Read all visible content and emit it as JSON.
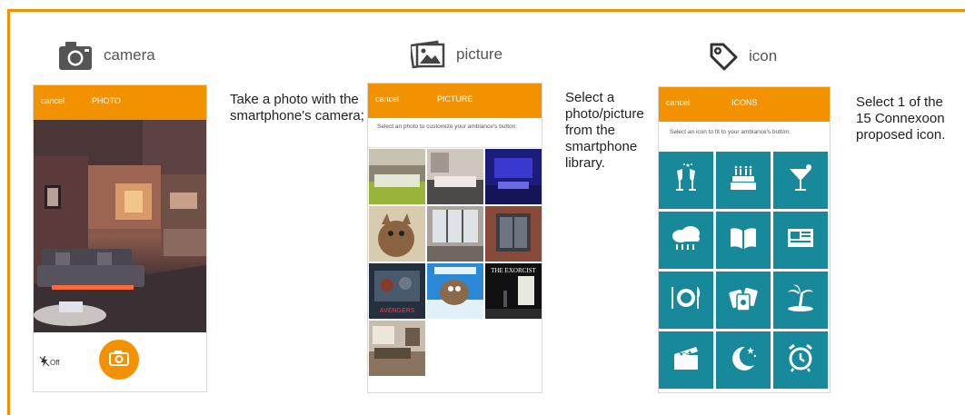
{
  "sections": {
    "camera": {
      "label": "camera",
      "phone": {
        "cancel": "cancel",
        "title": "PHOTO",
        "flash_label": "Off"
      },
      "description": "Take a photo with the smartphone's camera;"
    },
    "picture": {
      "label": "picture",
      "phone": {
        "cancel": "cancel",
        "title": "PICTURE",
        "hint": "Select an photo to customize your ambiance's button:",
        "photos": [
          "bedroom-green",
          "bedroom-grey",
          "bedroom-blue",
          "kitten",
          "loft-window",
          "brick-window",
          "avengers-poster",
          "ice-age-poster",
          "exorcist-poster",
          "living-room"
        ],
        "poster_text": {
          "exorcist": "THE EXORCIST",
          "avengers": "AVENGERS"
        }
      },
      "description": "Select a photo/picture from the smartphone library."
    },
    "icon": {
      "label": "icon",
      "phone": {
        "cancel": "cancel",
        "title": "ICONS",
        "hint": "Select an icon to fit to your ambiance's button:",
        "icons": [
          "champagne-icon",
          "birthday-cake-icon",
          "cocktail-icon",
          "rain-cloud-icon",
          "book-icon",
          "newspaper-icon",
          "dinner-plate-icon",
          "playing-cards-icon",
          "palm-island-icon",
          "clapperboard-icon",
          "moon-stars-icon",
          "alarm-clock-icon"
        ]
      },
      "description": "Select 1 of the 15 Connexoon proposed icon."
    }
  },
  "colors": {
    "accent": "#f39200",
    "icon_tile": "#17899a"
  }
}
